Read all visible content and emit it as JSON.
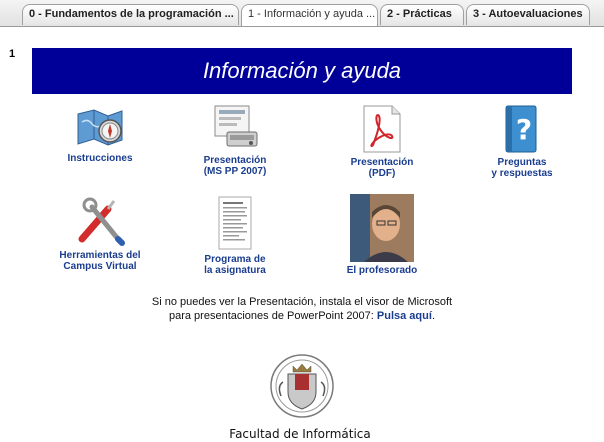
{
  "tabs": [
    {
      "label": "0 - Fundamentos de la programación ...",
      "active": false
    },
    {
      "label": "1 - Información y ayuda ...",
      "active": true
    },
    {
      "label": "2 - Prácticas",
      "active": false
    },
    {
      "label": "3 - Autoevaluaciones",
      "active": false
    }
  ],
  "section": {
    "number": "1"
  },
  "banner": {
    "title": "Información y ayuda",
    "color": "#000099"
  },
  "items": [
    {
      "label": "Instrucciones",
      "icon": "map-compass-icon"
    },
    {
      "label": "Presentación\n(MS PP 2007)",
      "icon": "projector-icon"
    },
    {
      "label": "Presentación\n(PDF)",
      "icon": "pdf-icon"
    },
    {
      "label": "Preguntas\ny respuestas",
      "icon": "question-book-icon"
    },
    {
      "label": "Herramientas del\nCampus Virtual",
      "icon": "tools-icon"
    },
    {
      "label": "Programa de\nla asignatura",
      "icon": "document-icon"
    },
    {
      "label": "El profesorado",
      "icon": "teacher-photo"
    }
  ],
  "notice": {
    "line1": "Si no puedes ver la Presentación, instala el visor de Microsoft",
    "line2": "para presentaciones de PowerPoint 2007: ",
    "link": "Pulsa aquí",
    "end": "."
  },
  "footer": {
    "faculty": "Facultad de Informática",
    "seal_icon": "university-seal-icon"
  },
  "colors": {
    "link": "#1a3d8f",
    "banner": "#000099"
  }
}
